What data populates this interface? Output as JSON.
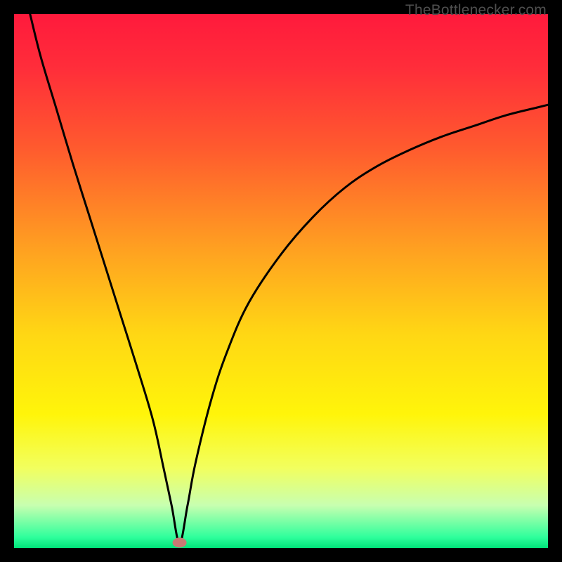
{
  "watermark": "TheBottlenecker.com",
  "chart_data": {
    "type": "line",
    "title": "",
    "xlabel": "",
    "ylabel": "",
    "xlim": [
      0,
      100
    ],
    "ylim": [
      0,
      100
    ],
    "background_gradient_stops": [
      {
        "pos": 0.0,
        "color": "#ff1a3c"
      },
      {
        "pos": 0.1,
        "color": "#ff2d3a"
      },
      {
        "pos": 0.25,
        "color": "#ff5a2e"
      },
      {
        "pos": 0.45,
        "color": "#ffa420"
      },
      {
        "pos": 0.6,
        "color": "#ffd714"
      },
      {
        "pos": 0.75,
        "color": "#fff50a"
      },
      {
        "pos": 0.85,
        "color": "#f2ff5e"
      },
      {
        "pos": 0.92,
        "color": "#c8ffb0"
      },
      {
        "pos": 0.98,
        "color": "#2eff9c"
      },
      {
        "pos": 1.0,
        "color": "#00e47a"
      }
    ],
    "curve_min_x": 31,
    "marker": {
      "x": 31,
      "y": 1,
      "color": "#c97a74"
    },
    "series": [
      {
        "name": "bottleneck-curve",
        "x": [
          3.0,
          5,
          8,
          11,
          14,
          17,
          20,
          23,
          26,
          28,
          29.5,
          31,
          32.5,
          34,
          37,
          40,
          44,
          50,
          56,
          62,
          68,
          74,
          80,
          86,
          92,
          98,
          100
        ],
        "values": [
          100,
          92,
          82,
          72,
          62.5,
          53,
          43.5,
          34,
          24,
          15,
          8,
          1,
          8,
          16,
          28,
          37,
          46,
          55,
          62,
          67.5,
          71.5,
          74.5,
          77,
          79,
          81,
          82.5,
          83
        ]
      }
    ]
  }
}
